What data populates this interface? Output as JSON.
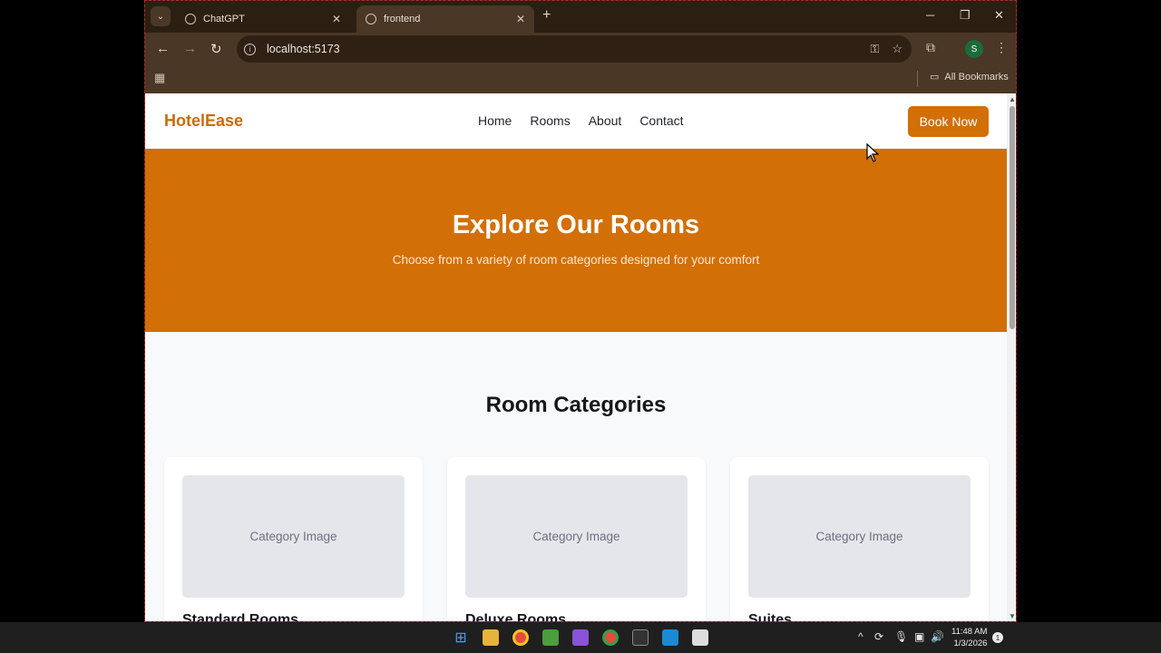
{
  "browser": {
    "tabs": [
      {
        "title": "ChatGPT",
        "active": false
      },
      {
        "title": "frontend",
        "active": true
      }
    ],
    "address": "localhost:5173",
    "bookmarks_label": "All Bookmarks",
    "profile_initial": "S"
  },
  "site": {
    "brand": "HotelEase",
    "nav": [
      "Home",
      "Rooms",
      "About",
      "Contact"
    ],
    "cta": "Book Now",
    "hero": {
      "title": "Explore Our Rooms",
      "subtitle": "Choose from a variety of room categories designed for your comfort"
    },
    "section_title": "Room Categories",
    "cards": [
      {
        "image_label": "Category Image",
        "name": "Standard Rooms"
      },
      {
        "image_label": "Category Image",
        "name": "Deluxe Rooms"
      },
      {
        "image_label": "Category Image",
        "name": "Suites"
      }
    ]
  },
  "taskbar": {
    "time": "11:48 AM",
    "date": "1/3/2026",
    "notification_count": "1"
  },
  "colors": {
    "brand": "#c96b09",
    "hero_bg": "#d26f07",
    "chrome_frame": "#4a3725"
  }
}
